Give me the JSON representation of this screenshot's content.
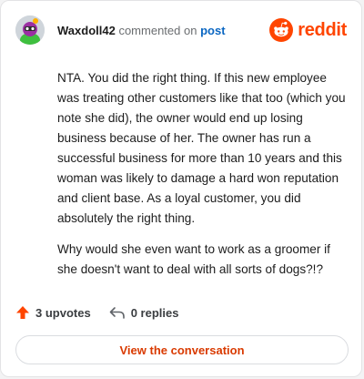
{
  "comment": {
    "username": "Waxdoll42",
    "action_text": "commented on",
    "post_link": "post",
    "paragraphs": [
      "NTA. You did the right thing. If this new employee was treating other customers like that too (which you note she did), the owner would end up losing business because of her. The owner has run a successful business for more than 10 years and this woman was likely to damage a hard won reputation and client base. As a loyal customer, you did absolutely the right thing.",
      "Why would she even want to work as a groomer if she doesn't want to deal with all sorts of dogs?!?"
    ]
  },
  "brand": {
    "name": "reddit",
    "color": "#ff4500"
  },
  "actions": {
    "upvotes": "3 upvotes",
    "replies": "0 replies"
  },
  "footer": {
    "button_label": "View the conversation"
  },
  "icons": {
    "avatar": "avatar",
    "logo": "reddit-snoo-icon",
    "upvote": "upvote-arrow-icon",
    "reply": "reply-icon"
  }
}
